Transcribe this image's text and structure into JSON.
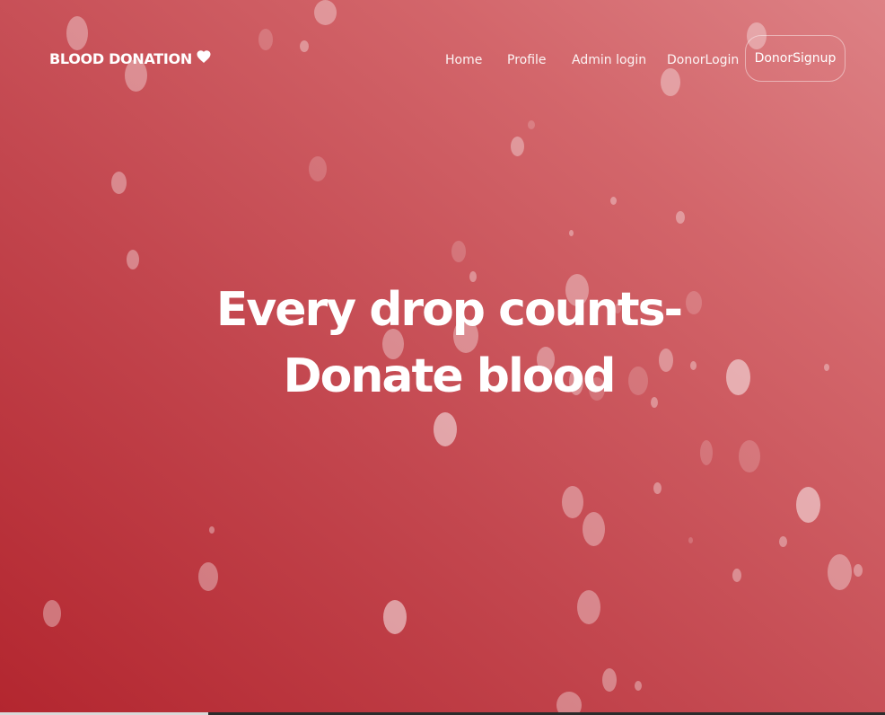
{
  "brand": {
    "title": "BLOOD DONATION",
    "icon": "heart-icon"
  },
  "nav": {
    "items": [
      {
        "label": "Home"
      },
      {
        "label": "Profile"
      },
      {
        "label": "Admin login"
      },
      {
        "label": "DonorLogin"
      }
    ],
    "signup_label": "DonorSignup"
  },
  "hero": {
    "line1": "Every drop counts-",
    "line2": "Donate blood"
  },
  "colors": {
    "gradient_start": "#b3262f",
    "gradient_end": "#dd8185",
    "text": "#ffffff"
  }
}
